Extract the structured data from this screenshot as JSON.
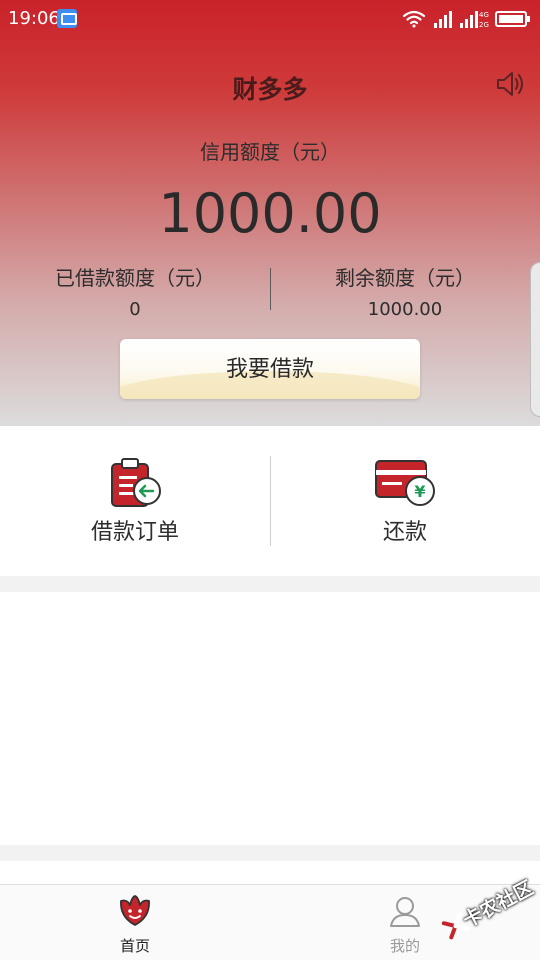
{
  "status_bar": {
    "time": "19:06",
    "icons": [
      "message-notification-icon",
      "wifi-icon",
      "signal-icon",
      "dual-signal-4g-2g-icon",
      "battery-icon"
    ],
    "network_labels": [
      "4G",
      "2G"
    ]
  },
  "header": {
    "title": "财多多",
    "sound_icon": "speaker-icon"
  },
  "credit": {
    "label": "信用额度（元）",
    "amount": "1000.00"
  },
  "stats": {
    "borrowed_label": "已借款额度（元）",
    "borrowed_value": "0",
    "remaining_label": "剩余额度（元）",
    "remaining_value": "1000.00"
  },
  "borrow_button": {
    "label": "我要借款"
  },
  "actions": {
    "orders_label": "借款订单",
    "orders_icon": "clipboard-order-icon",
    "repay_label": "还款",
    "repay_icon": "card-yuan-icon",
    "repay_symbol": "¥"
  },
  "bottom_nav": {
    "home_label": "首页",
    "home_icon": "tulip-home-icon",
    "mine_label": "我的",
    "mine_icon": "user-icon"
  },
  "watermark": {
    "text": "卡农社区"
  },
  "colors": {
    "brand_red": "#c9222a",
    "icon_red": "#c4252b",
    "icon_green": "#1f9a55",
    "button_cream": "#f8edc8"
  }
}
